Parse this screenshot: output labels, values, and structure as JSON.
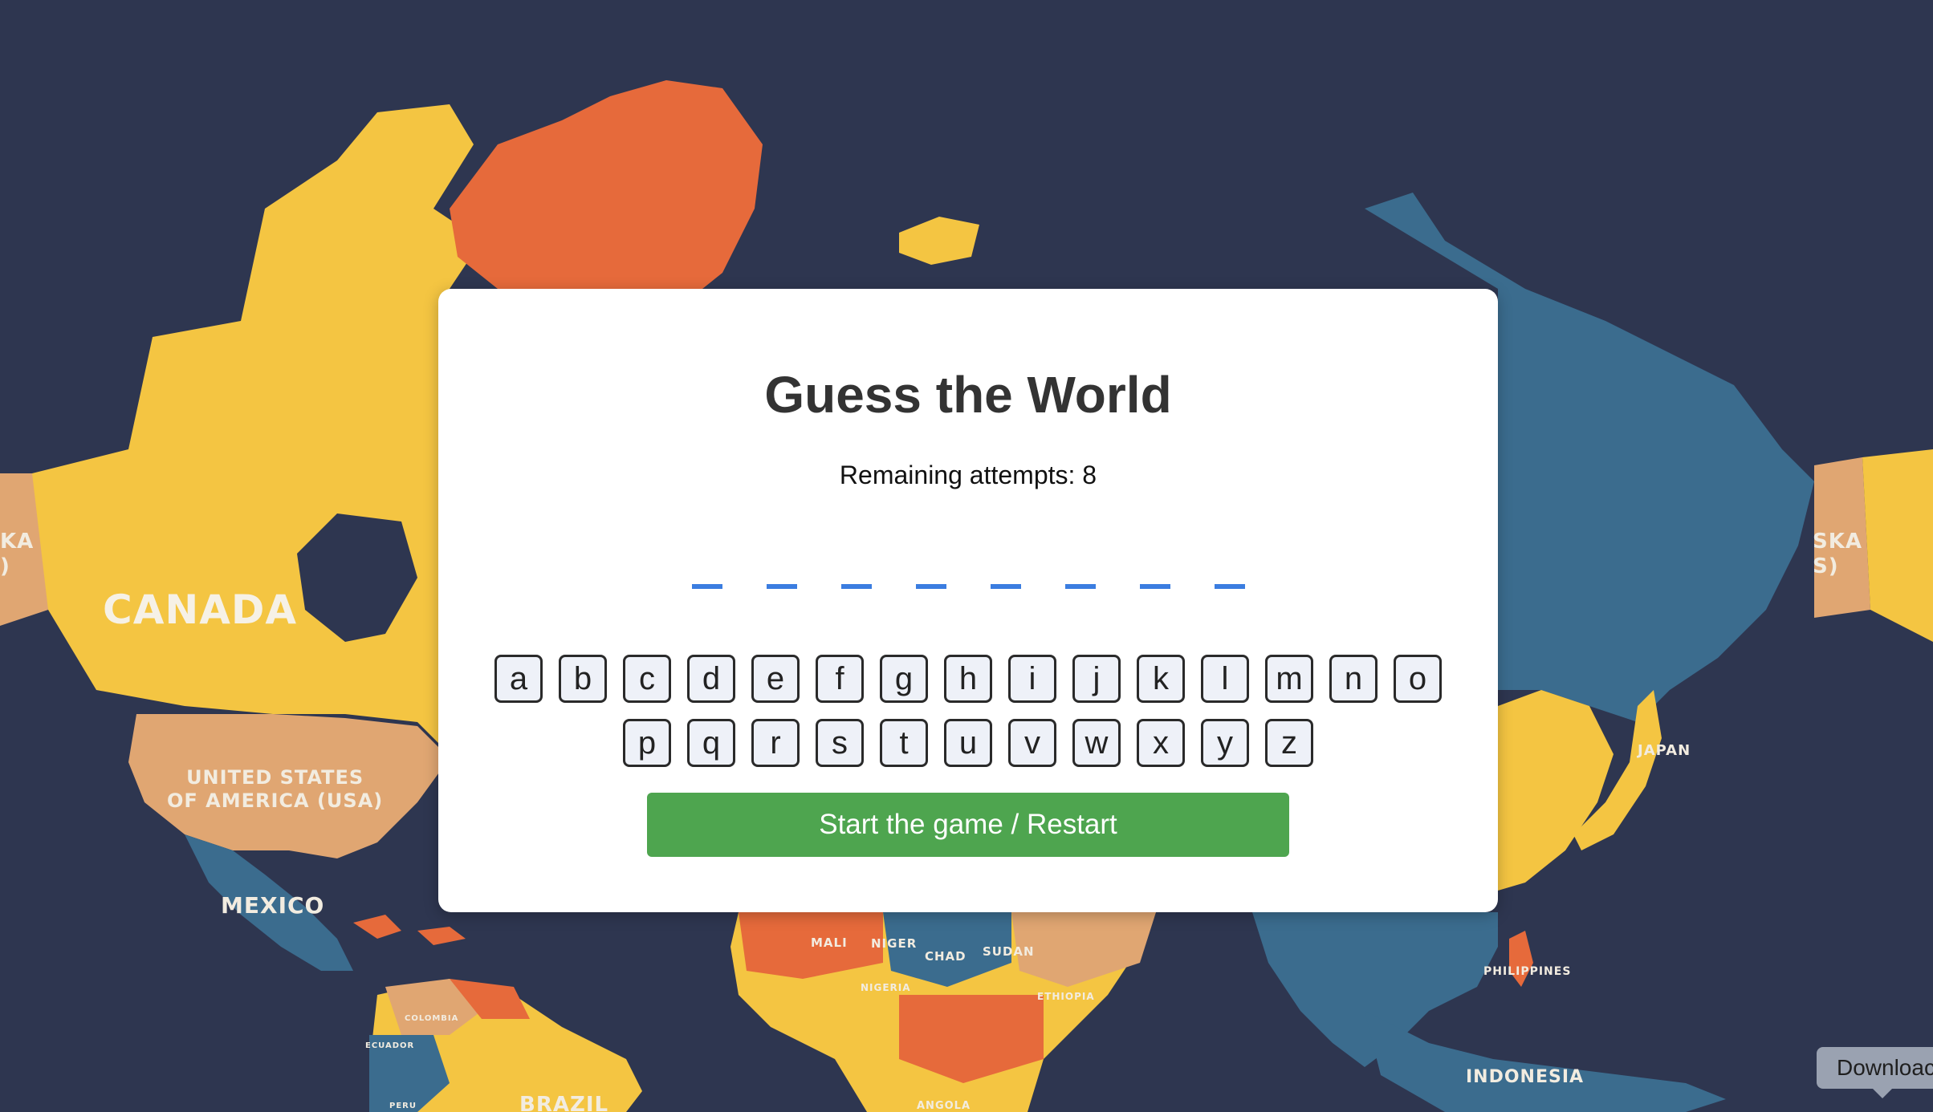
{
  "game": {
    "title": "Guess the World",
    "attempts_label": "Remaining attempts: 8",
    "remaining_attempts": 8,
    "word_length": 8,
    "keyboard_rows": [
      [
        "a",
        "b",
        "c",
        "d",
        "e",
        "f",
        "g",
        "h",
        "i",
        "j",
        "k",
        "l",
        "m",
        "n",
        "o"
      ],
      [
        "p",
        "q",
        "r",
        "s",
        "t",
        "u",
        "v",
        "w",
        "x",
        "y",
        "z"
      ]
    ],
    "start_button_label": "Start the game / Restart"
  },
  "map": {
    "labels": [
      {
        "id": "canada",
        "text": "CANADA"
      },
      {
        "id": "usa",
        "text": "UNITED STATES\nOF AMERICA (USA)"
      },
      {
        "id": "mexico",
        "text": "MEXICO"
      },
      {
        "id": "japan",
        "text": "JAPAN"
      },
      {
        "id": "indonesia",
        "text": "INDONESIA"
      },
      {
        "id": "philippines",
        "text": "PHILIPPINES"
      },
      {
        "id": "brazil",
        "text": "BRAZIL"
      },
      {
        "id": "mali",
        "text": "MALI"
      },
      {
        "id": "niger",
        "text": "NIGER"
      },
      {
        "id": "chad",
        "text": "CHAD"
      },
      {
        "id": "sudan",
        "text": "SUDAN"
      },
      {
        "id": "nigeria",
        "text": "NIGERIA"
      },
      {
        "id": "ethiopia",
        "text": "ETHIOPIA"
      },
      {
        "id": "angola",
        "text": "ANGOLA"
      },
      {
        "id": "colombia",
        "text": "COLOMBIA"
      },
      {
        "id": "ecuador",
        "text": "ECUADOR"
      },
      {
        "id": "peru",
        "text": "PERU"
      },
      {
        "id": "alaska-left",
        "text": "KA\n)"
      },
      {
        "id": "alaska-right",
        "text": "SKA\nS)"
      }
    ],
    "colors": {
      "ocean": "#2e3650",
      "yellow": "#f4c542",
      "orange": "#e66a3b",
      "tan": "#e0a672",
      "teal": "#3b6c8e"
    }
  },
  "tooltip": {
    "label": "Downloac"
  },
  "colors": {
    "slot": "#3b7de0",
    "start_button": "#4ea54f",
    "card": "#ffffff"
  }
}
